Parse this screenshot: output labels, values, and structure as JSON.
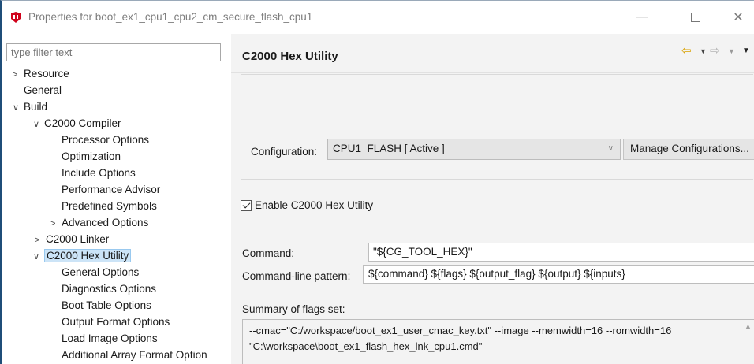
{
  "window": {
    "title": "Properties for boot_ex1_cpu1_cpu2_cm_secure_flash_cpu1",
    "minimize_glyph": "—",
    "close_glyph": "✕",
    "icon": "ti-logo-icon"
  },
  "filter": {
    "placeholder": "type filter text"
  },
  "tree": {
    "items": [
      {
        "label": "Resource",
        "twisty": ">"
      },
      {
        "label": "General",
        "twisty": ""
      },
      {
        "label": "Build",
        "twisty": "∨"
      },
      {
        "label": "C2000 Compiler",
        "twisty": "∨"
      },
      {
        "label": "Processor Options",
        "twisty": ""
      },
      {
        "label": "Optimization",
        "twisty": ""
      },
      {
        "label": "Include Options",
        "twisty": ""
      },
      {
        "label": "Performance Advisor",
        "twisty": ""
      },
      {
        "label": "Predefined Symbols",
        "twisty": ""
      },
      {
        "label": "Advanced Options",
        "twisty": ">"
      },
      {
        "label": "C2000 Linker",
        "twisty": ">"
      },
      {
        "label": "C2000 Hex Utility",
        "twisty": "∨"
      },
      {
        "label": "General Options",
        "twisty": ""
      },
      {
        "label": "Diagnostics Options",
        "twisty": ""
      },
      {
        "label": "Boot Table Options",
        "twisty": ""
      },
      {
        "label": "Output Format Options",
        "twisty": ""
      },
      {
        "label": "Load Image Options",
        "twisty": ""
      },
      {
        "label": "Additional Array Format Option",
        "twisty": ""
      }
    ]
  },
  "header": {
    "title": "C2000 Hex Utility",
    "back_glyph": "⇦",
    "forward_glyph": "⇨",
    "dropdown_glyph": "▼"
  },
  "config": {
    "label": "Configuration:",
    "value": "CPU1_FLASH  [ Active ]",
    "chevron": "∨",
    "manage_label": "Manage Configurations..."
  },
  "enable": {
    "label": "Enable C2000 Hex Utility",
    "checked": true
  },
  "command": {
    "label": "Command:",
    "value": "\"${CG_TOOL_HEX}\""
  },
  "pattern": {
    "label": "Command-line pattern:",
    "value": "${command} ${flags} ${output_flag} ${output} ${inputs}"
  },
  "summary": {
    "label": "Summary of flags set:",
    "line1": "--cmac=\"C:/workspace/boot_ex1_user_cmac_key.txt\" --image --memwidth=16 --romwidth=16",
    "line2": "\"C:\\workspace\\boot_ex1_flash_hex_lnk_cpu1.cmd\"",
    "scroll_up_glyph": "▲"
  },
  "colors": {
    "accent_arrow": "#d9a100",
    "selection": "#cce4f7"
  }
}
